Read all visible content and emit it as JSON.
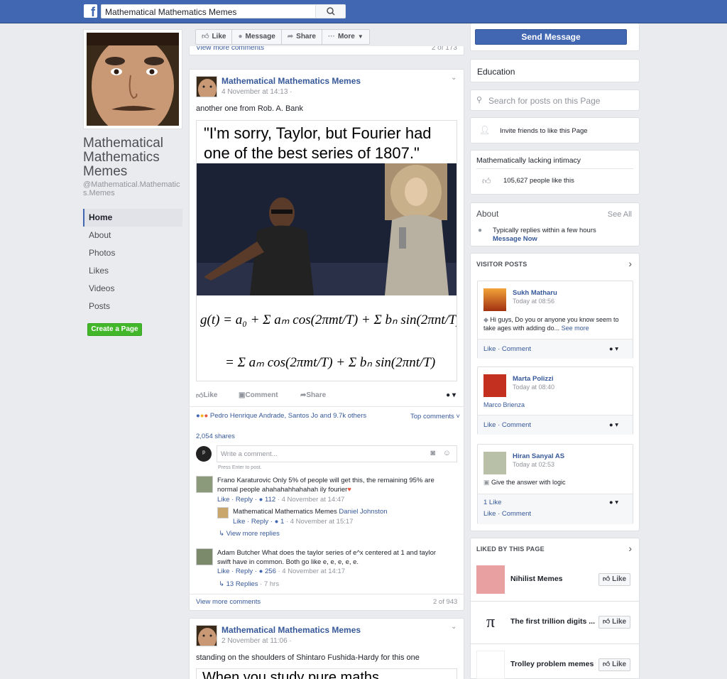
{
  "search": {
    "value": "Mathematical Mathematics Memes"
  },
  "page": {
    "title": "Mathematical Mathematics Memes",
    "handle": "@Mathematical.Mathematics.Memes",
    "nav": [
      "Home",
      "About",
      "Photos",
      "Likes",
      "Videos",
      "Posts"
    ],
    "create_page": "Create a Page"
  },
  "actionbar": {
    "like": "Like",
    "message": "Message",
    "share": "Share",
    "more": "More"
  },
  "top_strip": {
    "view_more": "View more comments",
    "count": "2 of 173"
  },
  "post1": {
    "author": "Mathematical Mathematics Memes",
    "time": "4 November at 14:13 ·",
    "text": "another one from Rob. A. Bank",
    "caption": "\"I'm sorry, Taylor, but Fourier had one of the best series of 1807.\"",
    "actions": {
      "like": "Like",
      "comment": "Comment",
      "share": "Share"
    },
    "reactions": "Pedro Henrique Andrade, Santos Jo and 9.7k others",
    "top_comments": "Top comments",
    "shares": "2,054 shares",
    "write_placeholder": "Write a comment...",
    "press_enter": "Press Enter to post.",
    "comments": [
      {
        "name": "Frano Karaturovic",
        "text": "Only 5% of people will get this, the remaining 95% are normal people ahahahahhahahah ily fourier",
        "links": "Like · Reply ·",
        "count": "112",
        "time": "· 4 November at 14:47"
      },
      {
        "name": "Mathematical Mathematics Memes",
        "text": "Daniel Johnston",
        "links": "Like · Reply ·",
        "count": "1",
        "time": "· 4 November at 15:17"
      },
      {
        "name": "Adam Butcher",
        "text": "What does the taylor series of e^x centered at 1 and taylor swift have in common. Both go like e, e, e, e, e.",
        "links": "Like · Reply ·",
        "count": "256",
        "time": "· 4 November at 14:17"
      }
    ],
    "view_more_replies": "View more replies",
    "replies": "13 Replies",
    "replies_time": "· 7 hrs",
    "view_more_comments": "View more comments",
    "comments_count": "2 of 943"
  },
  "post2": {
    "author": "Mathematical Mathematics Memes",
    "time": "2 November at 11:06 ·",
    "text": "standing on the shoulders of Shintaro Fushida-Hardy for this one",
    "caption": "When you study pure maths"
  },
  "right": {
    "send_message": "Send Message",
    "education": "Education",
    "search_posts": "Search for posts on this Page",
    "invite": "Invite friends to like this Page",
    "lacking": "Mathematically lacking intimacy",
    "likes": "105,627 people like this",
    "about": "About",
    "see_all": "See All",
    "replies_within": "Typically replies within a few hours",
    "message_now": "Message Now",
    "visitor_posts": "VISITOR POSTS",
    "visitors": [
      {
        "name": "Sukh Matharu",
        "time": "Today at 08:56",
        "text": "Hi guys, Do you or anyone you know seem to take ages with adding do...",
        "more": "See more",
        "foot": "Like · Comment"
      },
      {
        "name": "Marta Polizzi",
        "time": "Today at 08:40",
        "text": "Marco Brienza",
        "foot": "Like · Comment"
      },
      {
        "name": "Hiran Sanyal AS",
        "time": "Today at 02:53",
        "text": "Give the answer with logic",
        "likes": "1 Like",
        "foot": "Like · Comment"
      }
    ],
    "liked_by": "LIKED BY THIS PAGE",
    "liked": [
      {
        "name": "Nihilist Memes",
        "btn": "Like"
      },
      {
        "name": "The first trillion digits ...",
        "btn": "Like"
      },
      {
        "name": "Trolley problem memes",
        "btn": "Like"
      }
    ]
  }
}
